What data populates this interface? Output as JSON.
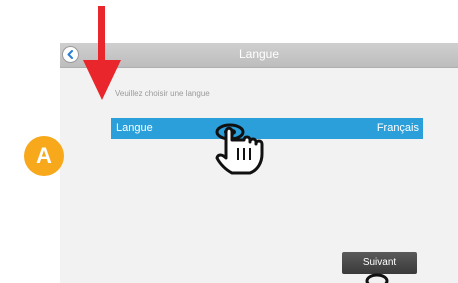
{
  "window": {
    "title": "Langue",
    "back_icon": "back-chevron-icon"
  },
  "content": {
    "prompt": "Veuillez choisir une langue",
    "language_row": {
      "label": "Langue",
      "value": "Français"
    }
  },
  "footer": {
    "next_label": "Suivant"
  },
  "annotation": {
    "marker_label": "A",
    "marker_color": "#f7a81b",
    "arrow_color": "#e8262b",
    "pointer_icon": "tap-hand-icon"
  },
  "colors": {
    "accent": "#2b9fd9",
    "titlebar": "#c6c6c6",
    "button_dark": "#444444"
  }
}
